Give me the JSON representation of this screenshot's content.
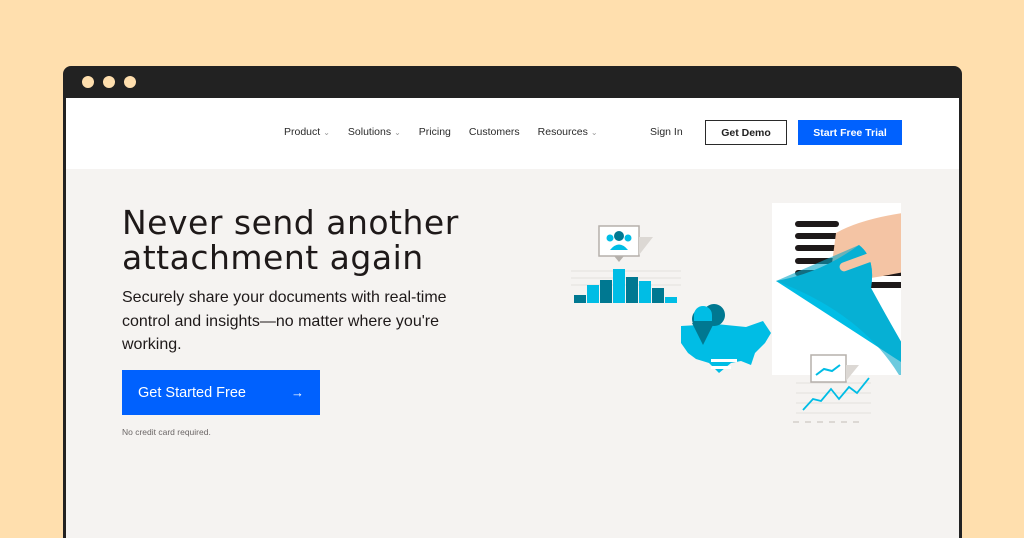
{
  "window": {
    "dots": [
      "dot-1",
      "dot-2",
      "dot-3"
    ]
  },
  "nav": {
    "links": [
      {
        "label": "Product",
        "has_dropdown": true
      },
      {
        "label": "Solutions",
        "has_dropdown": true
      },
      {
        "label": "Pricing",
        "has_dropdown": false
      },
      {
        "label": "Customers",
        "has_dropdown": false
      },
      {
        "label": "Resources",
        "has_dropdown": true
      }
    ],
    "caret": "⌄",
    "sign_in": "Sign In",
    "get_demo": "Get Demo",
    "start_trial": "Start Free Trial"
  },
  "hero": {
    "title_line1": "Never send another",
    "title_line2": "attachment again",
    "subtitle": "Securely share your documents with real-time control and insights—no matter where you're working.",
    "cta_label": "Get Started Free",
    "cta_arrow": "→",
    "note": "No credit card required."
  },
  "colors": {
    "brand_blue": "#0061fe",
    "accent_cyan": "#00bde5",
    "accent_teal": "#007891",
    "background_peach": "#ffdfae",
    "page_bg": "#f5f3f1"
  },
  "illustration": {
    "icons": [
      "audience-bar-chart-icon",
      "usa-map-pin-icon",
      "document-page-peel-icon",
      "line-chart-icon"
    ]
  }
}
